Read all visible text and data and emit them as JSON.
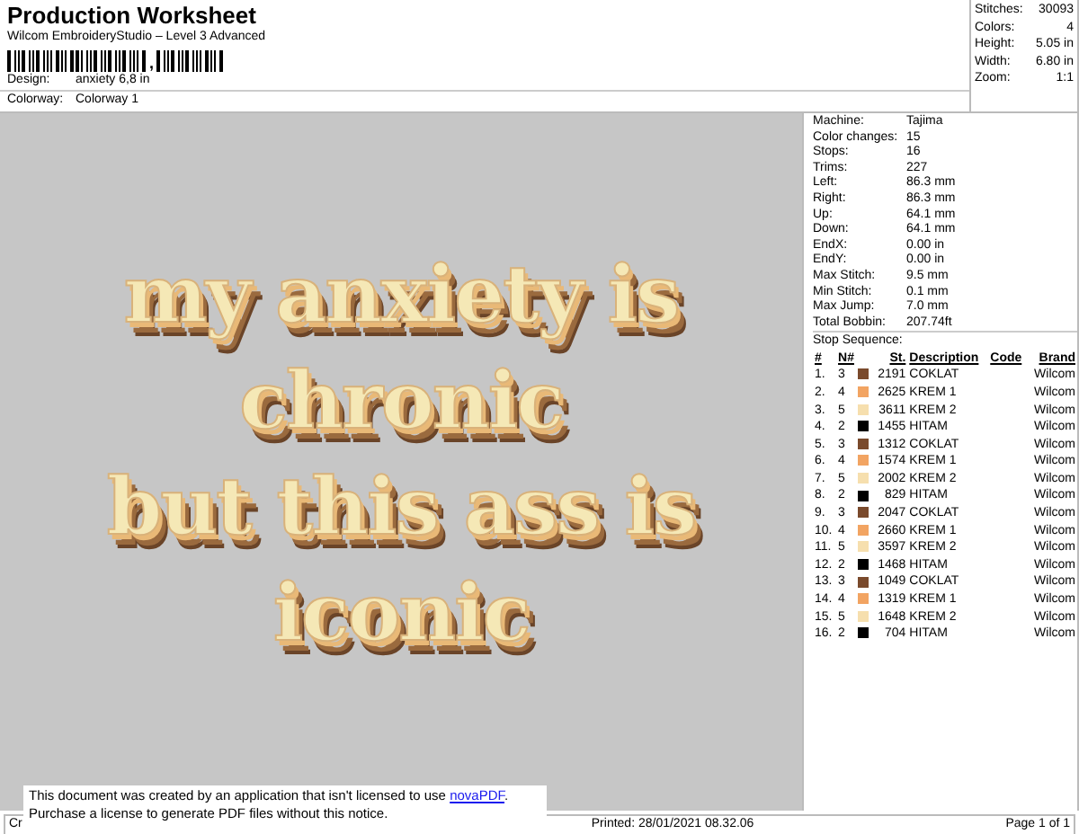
{
  "header": {
    "title": "Production Worksheet",
    "subtitle": "Wilcom EmbroideryStudio – Level 3 Advanced",
    "barcode_mark": ",",
    "fields": [
      {
        "label": "Design:",
        "value": "anxiety 6,8 in"
      },
      {
        "label": "Colorway:",
        "value": "Colorway 1"
      }
    ]
  },
  "summary": [
    {
      "label": "Stitches:",
      "value": "30093"
    },
    {
      "label": "Colors:",
      "value": "4"
    },
    {
      "label": "Height:",
      "value": "5.05 in"
    },
    {
      "label": "Width:",
      "value": "6.80 in"
    },
    {
      "label": "Zoom:",
      "value": "1:1"
    }
  ],
  "design_preview": {
    "lines": [
      "my anxiety is",
      "chronic",
      "but this ass is",
      "iconic"
    ]
  },
  "machine_info": [
    {
      "label": "Machine:",
      "value": "Tajima"
    },
    {
      "label": "Color changes:",
      "value": "15"
    },
    {
      "label": "Stops:",
      "value": "16"
    },
    {
      "label": "Trims:",
      "value": "227"
    },
    {
      "label": "Left:",
      "value": "86.3 mm"
    },
    {
      "label": "Right:",
      "value": "86.3 mm"
    },
    {
      "label": "Up:",
      "value": "64.1 mm"
    },
    {
      "label": "Down:",
      "value": "64.1 mm"
    },
    {
      "label": "EndX:",
      "value": "0.00 in"
    },
    {
      "label": "EndY:",
      "value": "0.00 in"
    },
    {
      "label": "Max Stitch:",
      "value": "9.5 mm"
    },
    {
      "label": "Min Stitch:",
      "value": "0.1 mm"
    },
    {
      "label": "Max Jump:",
      "value": "7.0 mm"
    },
    {
      "label": "Total Bobbin:",
      "value": "207.74ft"
    }
  ],
  "stop_sequence": {
    "title": "Stop Sequence:",
    "columns": [
      "#",
      "N#",
      "St.",
      "Description",
      "Code",
      "Brand"
    ],
    "rows": [
      {
        "index": "1.",
        "needle": "3",
        "color": "#7a4a2c",
        "stitches": "2191",
        "description": "COKLAT",
        "brand": "Wilcom"
      },
      {
        "index": "2.",
        "needle": "4",
        "color": "#f2a462",
        "stitches": "2625",
        "description": "KREM 1",
        "brand": "Wilcom"
      },
      {
        "index": "3.",
        "needle": "5",
        "color": "#f6dfae",
        "stitches": "3611",
        "description": "KREM 2",
        "brand": "Wilcom"
      },
      {
        "index": "4.",
        "needle": "2",
        "color": "#000000",
        "stitches": "1455",
        "description": "HITAM",
        "brand": "Wilcom"
      },
      {
        "index": "5.",
        "needle": "3",
        "color": "#7a4a2c",
        "stitches": "1312",
        "description": "COKLAT",
        "brand": "Wilcom"
      },
      {
        "index": "6.",
        "needle": "4",
        "color": "#f2a462",
        "stitches": "1574",
        "description": "KREM 1",
        "brand": "Wilcom"
      },
      {
        "index": "7.",
        "needle": "5",
        "color": "#f6dfae",
        "stitches": "2002",
        "description": "KREM 2",
        "brand": "Wilcom"
      },
      {
        "index": "8.",
        "needle": "2",
        "color": "#000000",
        "stitches": "829",
        "description": "HITAM",
        "brand": "Wilcom"
      },
      {
        "index": "9.",
        "needle": "3",
        "color": "#7a4a2c",
        "stitches": "2047",
        "description": "COKLAT",
        "brand": "Wilcom"
      },
      {
        "index": "10.",
        "needle": "4",
        "color": "#f2a462",
        "stitches": "2660",
        "description": "KREM 1",
        "brand": "Wilcom"
      },
      {
        "index": "11.",
        "needle": "5",
        "color": "#f6dfae",
        "stitches": "3597",
        "description": "KREM 2",
        "brand": "Wilcom"
      },
      {
        "index": "12.",
        "needle": "2",
        "color": "#000000",
        "stitches": "1468",
        "description": "HITAM",
        "brand": "Wilcom"
      },
      {
        "index": "13.",
        "needle": "3",
        "color": "#7a4a2c",
        "stitches": "1049",
        "description": "COKLAT",
        "brand": "Wilcom"
      },
      {
        "index": "14.",
        "needle": "4",
        "color": "#f2a462",
        "stitches": "1319",
        "description": "KREM 1",
        "brand": "Wilcom"
      },
      {
        "index": "15.",
        "needle": "5",
        "color": "#f6dfae",
        "stitches": "1648",
        "description": "KREM 2",
        "brand": "Wilcom"
      },
      {
        "index": "16.",
        "needle": "2",
        "color": "#000000",
        "stitches": "704",
        "description": "HITAM",
        "brand": "Wilcom"
      }
    ]
  },
  "footer": {
    "left": "Cr",
    "printed": "Printed: 28/01/2021 08.32.06",
    "page": "Page 1 of 1"
  },
  "notice": {
    "line_1": "This document was created by an application that isn't licensed to use",
    "link": "novaPDF",
    "link_end": ".",
    "line_2": "Purchase a license to generate PDF files without this notice."
  }
}
